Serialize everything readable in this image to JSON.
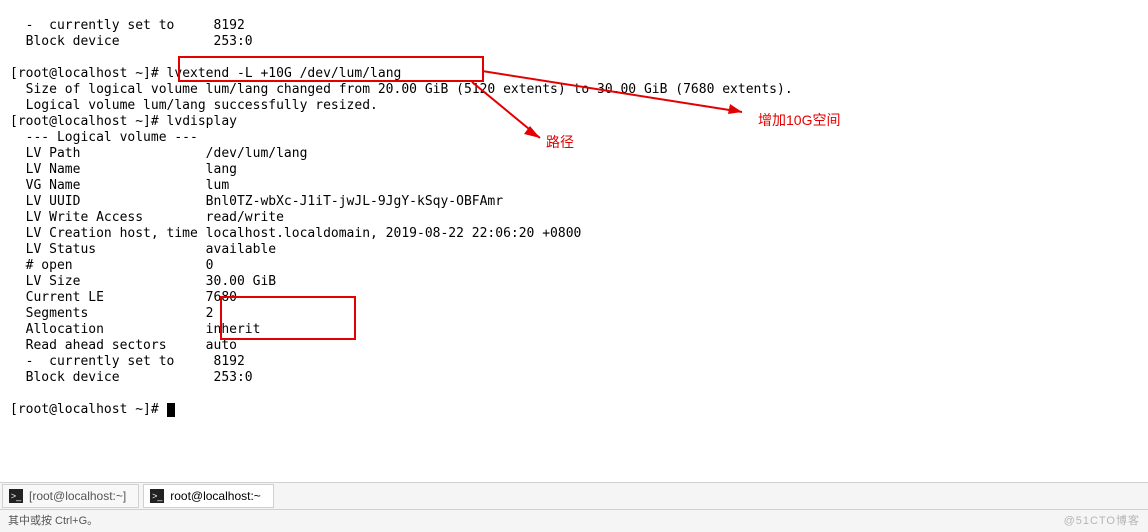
{
  "term": {
    "l0": "  -  currently set to     8192",
    "l1": "  Block device            253:0",
    "l2": "",
    "l3p": "[root@localhost ~]# ",
    "l3c": "lvextend -L +10G /dev/lum/lang",
    "l4": "  Size of logical volume lum/lang changed from 20.00 GiB (5120 extents) to 30.00 GiB (7680 extents).",
    "l5": "  Logical volume lum/lang successfully resized.",
    "l6p": "[root@localhost ~]# ",
    "l6c": "lvdisplay",
    "l7": "  --- Logical volume ---",
    "l8": "  LV Path                /dev/lum/lang",
    "l9": "  LV Name                lang",
    "l10": "  VG Name                lum",
    "l11": "  LV UUID                Bnl0TZ-wbXc-J1iT-jwJL-9JgY-kSqy-OBFAmr",
    "l12": "  LV Write Access        read/write",
    "l13": "  LV Creation host, time localhost.localdomain, 2019-08-22 22:06:20 +0800",
    "l14": "  LV Status              available",
    "l15": "  # open                 0",
    "l16": "  LV Size                30.00 GiB",
    "l17": "  Current LE             7680",
    "l18": "  Segments               2",
    "l19": "  Allocation             inherit",
    "l20": "  Read ahead sectors     auto",
    "l21": "  -  currently set to     8192",
    "l22": "  Block device            253:0",
    "l23": "",
    "l24p": "[root@localhost ~]# "
  },
  "annot": {
    "path": "路径",
    "addspace": "增加10G空间"
  },
  "tabs": {
    "inactive": "[root@localhost:~]",
    "active": "root@localhost:~"
  },
  "status": {
    "hint": "其中或按 Ctrl+G。",
    "wm": "@51CTO博客"
  }
}
